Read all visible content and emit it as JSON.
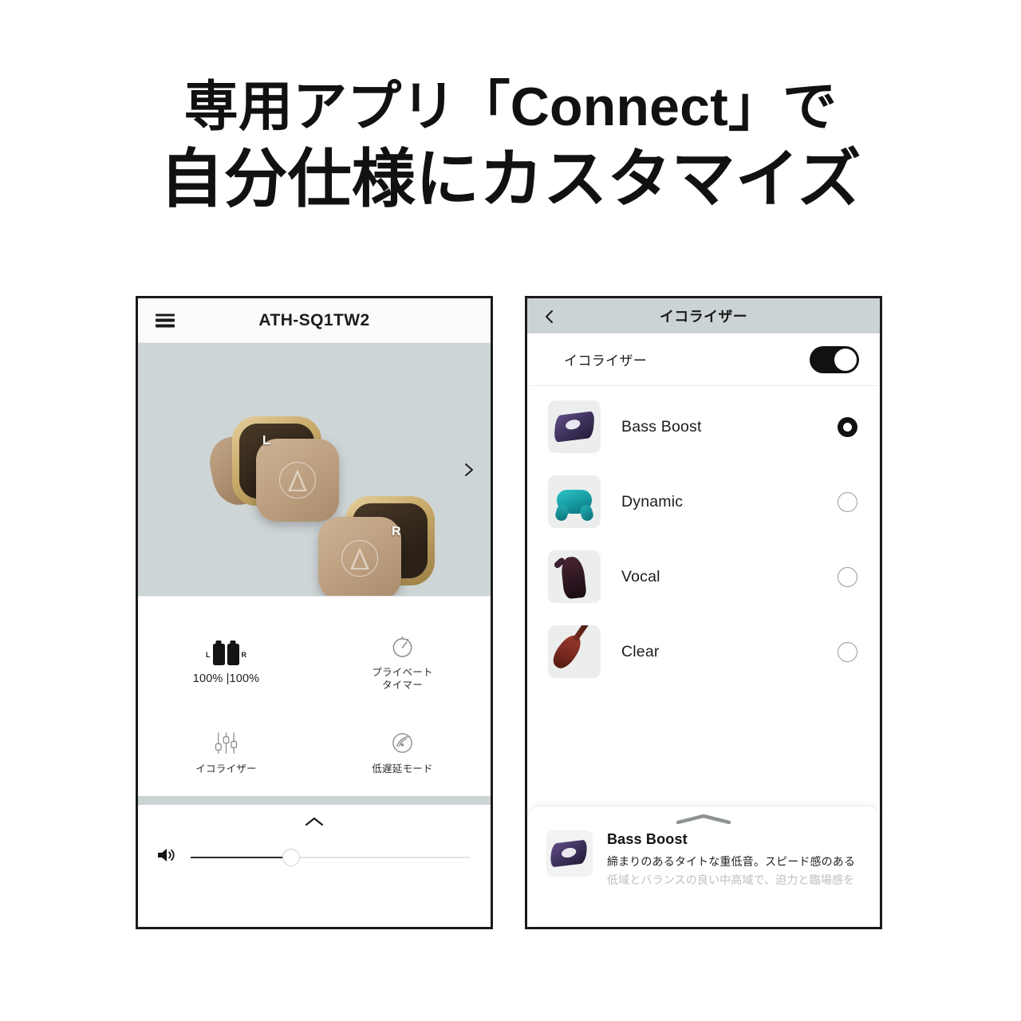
{
  "headline": {
    "line1": "専用アプリ「Connect」で",
    "line2": "自分仕様にカスタマイズ"
  },
  "left_phone": {
    "topbar": {
      "menu_icon": "hamburger-icon",
      "title": "ATH-SQ1TW2"
    },
    "hero": {
      "left_bud_label": "L",
      "right_bud_label": "R",
      "next_icon": "chevron-right-icon"
    },
    "tiles": [
      {
        "icon": "battery-pair-icon",
        "left_label": "L",
        "right_label": "R",
        "label": "100% |100%"
      },
      {
        "icon": "stopwatch-icon",
        "label": "プライベート\nタイマー",
        "label_line1": "プライベート",
        "label_line2": "タイマー"
      },
      {
        "icon": "equalizer-sliders-icon",
        "label": "イコライザー"
      },
      {
        "icon": "low-latency-radar-icon",
        "label": "低遅延モード"
      }
    ],
    "bottom": {
      "expand_icon": "chevron-up-icon",
      "volume_icon": "speaker-volume-icon",
      "volume_percent": 36
    }
  },
  "right_phone": {
    "topbar": {
      "back_icon": "chevron-left-icon",
      "title": "イコライザー"
    },
    "toggle_row": {
      "label": "イコライザー",
      "state": "on"
    },
    "presets": [
      {
        "name": "Bass Boost",
        "thumb": "turntable-image",
        "selected": true
      },
      {
        "name": "Dynamic",
        "thumb": "gamepad-image",
        "selected": false
      },
      {
        "name": "Vocal",
        "thumb": "singer-image",
        "selected": false
      },
      {
        "name": "Clear",
        "thumb": "violin-image",
        "selected": false
      }
    ],
    "sheet": {
      "handle_icon": "chevron-up-handle-icon",
      "thumb": "turntable-image",
      "title": "Bass Boost",
      "desc_line1": "締まりのあるタイトな重低音。スピード感のある",
      "desc_line2": "低域とバランスの良い中高域で、迫力と臨場感を"
    }
  },
  "colors": {
    "page_bg": "#ffffff",
    "phone_border": "#1a1a1a",
    "hero_bg": "#ced5d6",
    "header_bg": "#ccd3d4",
    "accent_dark": "#111111",
    "bud_gold": "#c7a968",
    "bud_beige": "#bda081"
  }
}
